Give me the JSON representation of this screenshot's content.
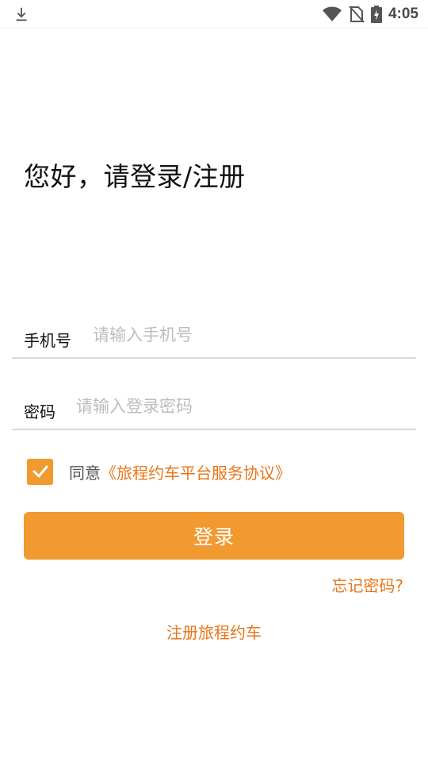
{
  "status_bar": {
    "time": "4:05",
    "icons": [
      "download-icon",
      "wifi-icon",
      "no-sim-icon",
      "battery-charging-icon"
    ]
  },
  "greeting": "您好，请登录/注册",
  "phone": {
    "label": "手机号",
    "placeholder": "请输入手机号",
    "value": ""
  },
  "password": {
    "label": "密码",
    "placeholder": "请输入登录密码",
    "value": ""
  },
  "agreement": {
    "checked": true,
    "prefix": "同意",
    "link": "《旅程约车平台服务协议》"
  },
  "login_button": "登录",
  "forgot_password": "忘记密码?",
  "register_link": "注册旅程约车",
  "colors": {
    "accent": "#f09a30",
    "link": "#e8761a",
    "divider": "#d9d9d9",
    "placeholder": "#bdbdbd"
  }
}
